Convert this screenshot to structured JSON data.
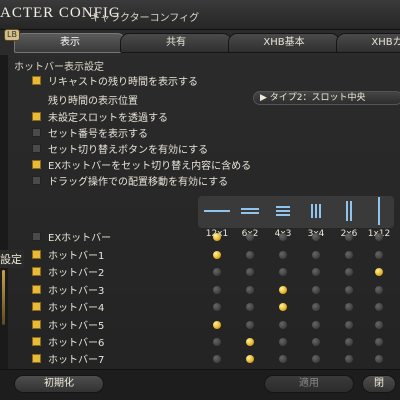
{
  "window": {
    "title": "ACTER CONFIG",
    "subtitle": "キャラクターコンフィグ",
    "tab_toggle_label": "LB"
  },
  "tabs": [
    {
      "label": "表示",
      "active": true
    },
    {
      "label": "共有",
      "active": false
    },
    {
      "label": "XHB基本",
      "active": false
    },
    {
      "label": "XHBカス",
      "active": false
    }
  ],
  "side_label": "設定",
  "section_title": "ホットバー表示設定",
  "options": [
    {
      "label": "リキャストの残り時間を表示する",
      "checked": true
    },
    {
      "label": "未設定スロットを透過する",
      "checked": true
    },
    {
      "label": "セット番号を表示する",
      "checked": false
    },
    {
      "label": "セット切り替えボタンを有効にする",
      "checked": false
    },
    {
      "label": "EXホットバーをセット切り替え内容に含める",
      "checked": true
    },
    {
      "label": "ドラッグ操作での配置移動を有効にする",
      "checked": false
    }
  ],
  "remaining_time_position": {
    "label": "残り時間の表示位置",
    "value": "▶ タイプ2：スロット中央"
  },
  "layouts": [
    "12x1",
    "6x2",
    "4x3",
    "3x4",
    "2x6",
    "1x12"
  ],
  "hotbars": [
    {
      "label": "EXホットバー",
      "checked": false,
      "selected_layout": 0
    },
    {
      "label": "ホットバー1",
      "checked": true,
      "selected_layout": 0
    },
    {
      "label": "ホットバー2",
      "checked": true,
      "selected_layout": 5
    },
    {
      "label": "ホットバー3",
      "checked": true,
      "selected_layout": 2
    },
    {
      "label": "ホットバー4",
      "checked": true,
      "selected_layout": 2
    },
    {
      "label": "ホットバー5",
      "checked": true,
      "selected_layout": 0
    },
    {
      "label": "ホットバー6",
      "checked": true,
      "selected_layout": 1
    },
    {
      "label": "ホットバー7",
      "checked": true,
      "selected_layout": 1
    }
  ],
  "footer": {
    "reset_label": "初期化",
    "apply_label": "適用",
    "close_label": "閉"
  },
  "colors": {
    "accent": "#e9b93a",
    "background": "#262626",
    "text": "#e8e4d8"
  }
}
